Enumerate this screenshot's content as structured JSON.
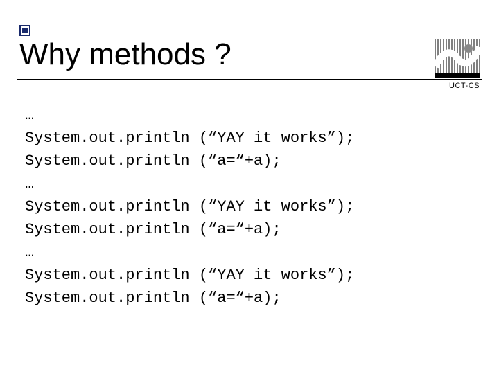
{
  "title": "Why methods ?",
  "label": "UCT-CS",
  "code": {
    "ellipsis": "…",
    "line_yay": "System.out.println (“YAY it works”);",
    "line_a": "System.out.println (“a=“+a);"
  }
}
